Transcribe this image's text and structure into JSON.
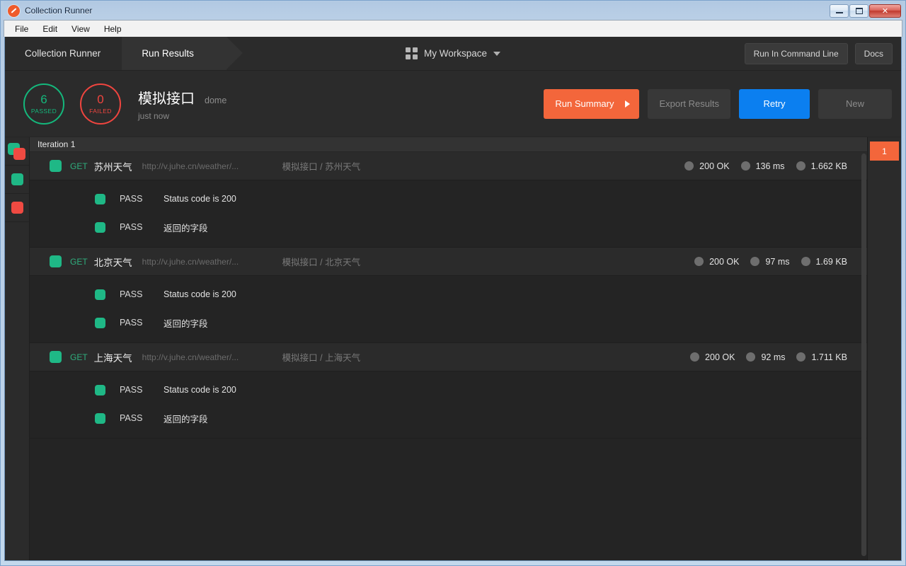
{
  "window": {
    "title": "Collection Runner",
    "logo_icon": "postman-logo-icon",
    "buttons": {
      "minimize": "minimize-icon",
      "maximize": "maximize-icon",
      "close": "✕"
    }
  },
  "menubar": {
    "items": [
      "File",
      "Edit",
      "View",
      "Help"
    ]
  },
  "topnav": {
    "crumbs": [
      {
        "label": "Collection Runner",
        "active": false
      },
      {
        "label": "Run Results",
        "active": true
      }
    ],
    "workspace": {
      "icon": "grid-icon",
      "label": "My Workspace",
      "caret": "chevron-down-icon"
    },
    "buttons": [
      {
        "label": "Run In Command Line"
      },
      {
        "label": "Docs"
      }
    ]
  },
  "summary": {
    "passed": {
      "count": "6",
      "label": "PASSED",
      "color": "#14b87c"
    },
    "failed": {
      "count": "0",
      "label": "FAILED",
      "color": "#f0453f"
    },
    "run_title": "模拟接口",
    "run_subtitle": "dome",
    "run_time": "just now",
    "actions": [
      {
        "label": "Run Summary",
        "style": "primary",
        "enabled": true
      },
      {
        "label": "Export Results",
        "style": "muted",
        "enabled": false
      },
      {
        "label": "Retry",
        "style": "blue",
        "enabled": true
      },
      {
        "label": "New",
        "style": "muted",
        "enabled": false
      }
    ]
  },
  "left_rail": {
    "items": [
      {
        "name": "filter-all",
        "icon": "green-red-squares-icon"
      },
      {
        "name": "filter-passed",
        "icon": "green-square-icon"
      },
      {
        "name": "filter-failed",
        "icon": "red-square-icon"
      }
    ]
  },
  "results": {
    "iteration_header": "Iteration 1",
    "requests": [
      {
        "method": "GET",
        "name": "苏州天气",
        "url": "http://v.juhe.cn/weather/...",
        "path": "模拟接口 / 苏州天气",
        "status": "200 OK",
        "time": "136 ms",
        "size": "1.662 KB",
        "tests": [
          {
            "status": "PASS",
            "name": "Status code is 200"
          },
          {
            "status": "PASS",
            "name": "返回的字段"
          }
        ]
      },
      {
        "method": "GET",
        "name": "北京天气",
        "url": "http://v.juhe.cn/weather/...",
        "path": "模拟接口 / 北京天气",
        "status": "200 OK",
        "time": "97 ms",
        "size": "1.69 KB",
        "tests": [
          {
            "status": "PASS",
            "name": "Status code is 200"
          },
          {
            "status": "PASS",
            "name": "返回的字段"
          }
        ]
      },
      {
        "method": "GET",
        "name": "上海天气",
        "url": "http://v.juhe.cn/weather/...",
        "path": "模拟接口 / 上海天气",
        "status": "200 OK",
        "time": "92 ms",
        "size": "1.711 KB",
        "tests": [
          {
            "status": "PASS",
            "name": "Status code is 200"
          },
          {
            "status": "PASS",
            "name": "返回的字段"
          }
        ]
      }
    ]
  },
  "iteration_rail": {
    "chips": [
      "1"
    ]
  },
  "colors": {
    "accent_orange": "#f3663b",
    "accent_blue": "#0b7ff0",
    "pass_green": "#1fb886",
    "fail_red": "#ef4a42",
    "bg_dark": "#242424",
    "bg_panel": "#2b2b2b"
  }
}
